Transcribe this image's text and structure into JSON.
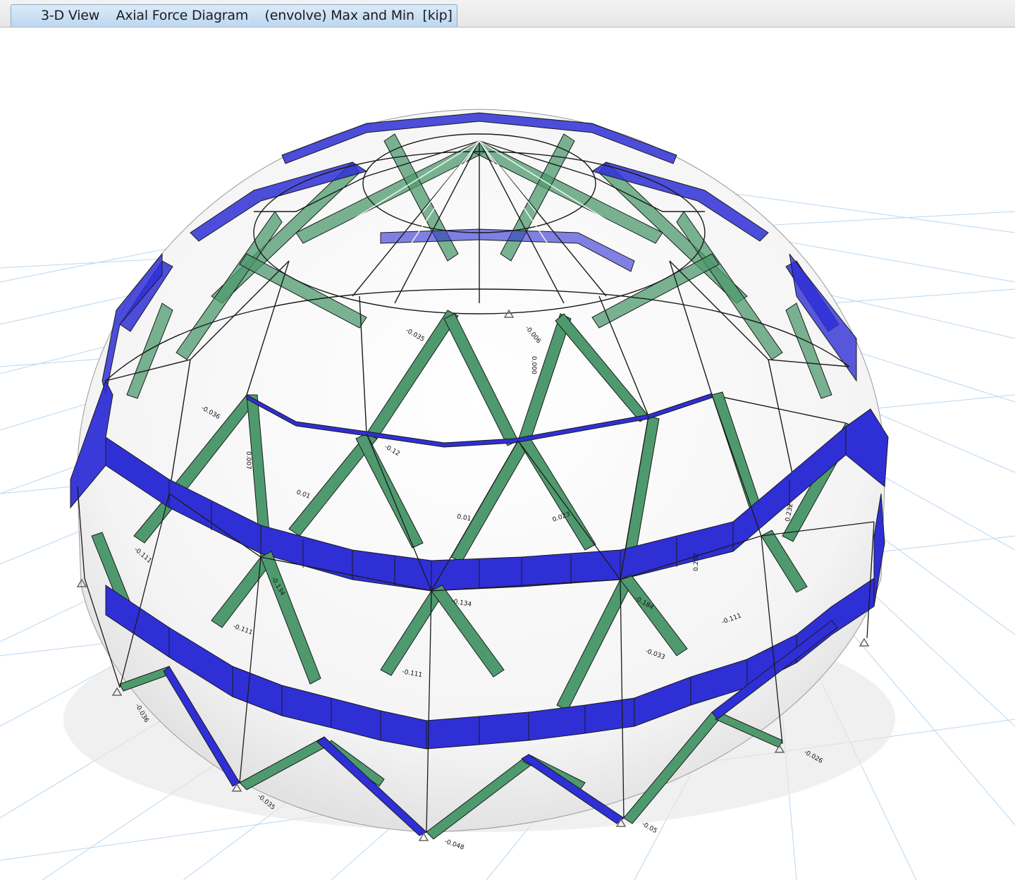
{
  "window": {
    "tab_title": "3-D View    Axial Force Diagram    (envolve) Max and Min  [kip]"
  },
  "colors": {
    "compression_fill": "#2f2fd6",
    "tension_fill": "#4e9a6e",
    "grid_line": "#b9d7f0",
    "frame_line": "#1a1a1a",
    "background": "#ffffff"
  },
  "icons": [
    "support-pin-icon"
  ],
  "force_labels": [
    {
      "id": "l1",
      "text": "-0.111"
    },
    {
      "id": "l2",
      "text": "-0.111"
    },
    {
      "id": "l3",
      "text": "-0.134"
    },
    {
      "id": "l4",
      "text": "-0.134"
    },
    {
      "id": "l5",
      "text": "-0.111"
    },
    {
      "id": "l6",
      "text": "-0.111"
    },
    {
      "id": "l7",
      "text": "-0.12"
    },
    {
      "id": "l8",
      "text": "-0.035"
    },
    {
      "id": "l9",
      "text": "-0.036"
    },
    {
      "id": "l10",
      "text": "-0.035"
    },
    {
      "id": "l11",
      "text": "-0.048"
    },
    {
      "id": "l12",
      "text": "-0.05"
    },
    {
      "id": "l13",
      "text": "-0.036"
    },
    {
      "id": "l14",
      "text": "-0.026"
    },
    {
      "id": "l15",
      "text": "0.232"
    },
    {
      "id": "l16",
      "text": "0.232"
    },
    {
      "id": "l17",
      "text": "0.01"
    },
    {
      "id": "l18",
      "text": "0.01"
    },
    {
      "id": "l19",
      "text": "0.023"
    },
    {
      "id": "l20",
      "text": "0.007"
    },
    {
      "id": "l21",
      "text": "0.000"
    },
    {
      "id": "l22",
      "text": "-0.184"
    },
    {
      "id": "l23",
      "text": "-0.006"
    },
    {
      "id": "l24",
      "text": "-0.033"
    }
  ]
}
